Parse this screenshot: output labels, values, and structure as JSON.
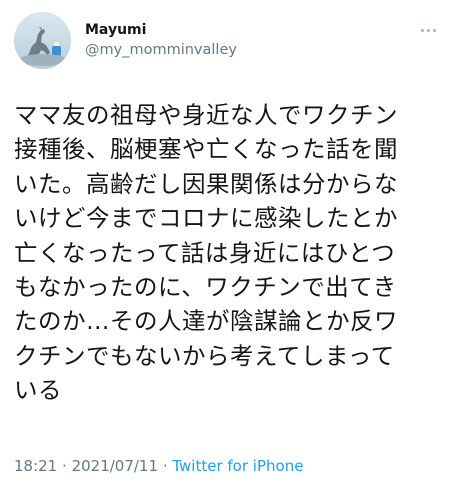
{
  "tweet": {
    "display_name": "Mayumi",
    "handle": "@my_momminvalley",
    "more_icon": "more-options-icon",
    "text_lines": [
      "ママ友の祖母や身近な人でワクチン",
      "接種後、脳梗塞や亡くなった話を聞",
      "いた。高齢だし因果関係は分からな",
      "いけど今までコロナに感染したとか",
      "亡くなったって話は身近にはひとつ",
      "もなかったのに、ワクチンで出てき",
      "たのか…その人達が陰謀論とか反ワ",
      "クチンでもないから考えてしまって",
      "いる"
    ],
    "time": "18:21",
    "separator": "·",
    "date": "2021/07/11",
    "source": "Twitter for iPhone"
  },
  "colors": {
    "text": "#14171a",
    "secondary": "#657786",
    "link": "#1da1f2",
    "background": "#ffffff"
  }
}
